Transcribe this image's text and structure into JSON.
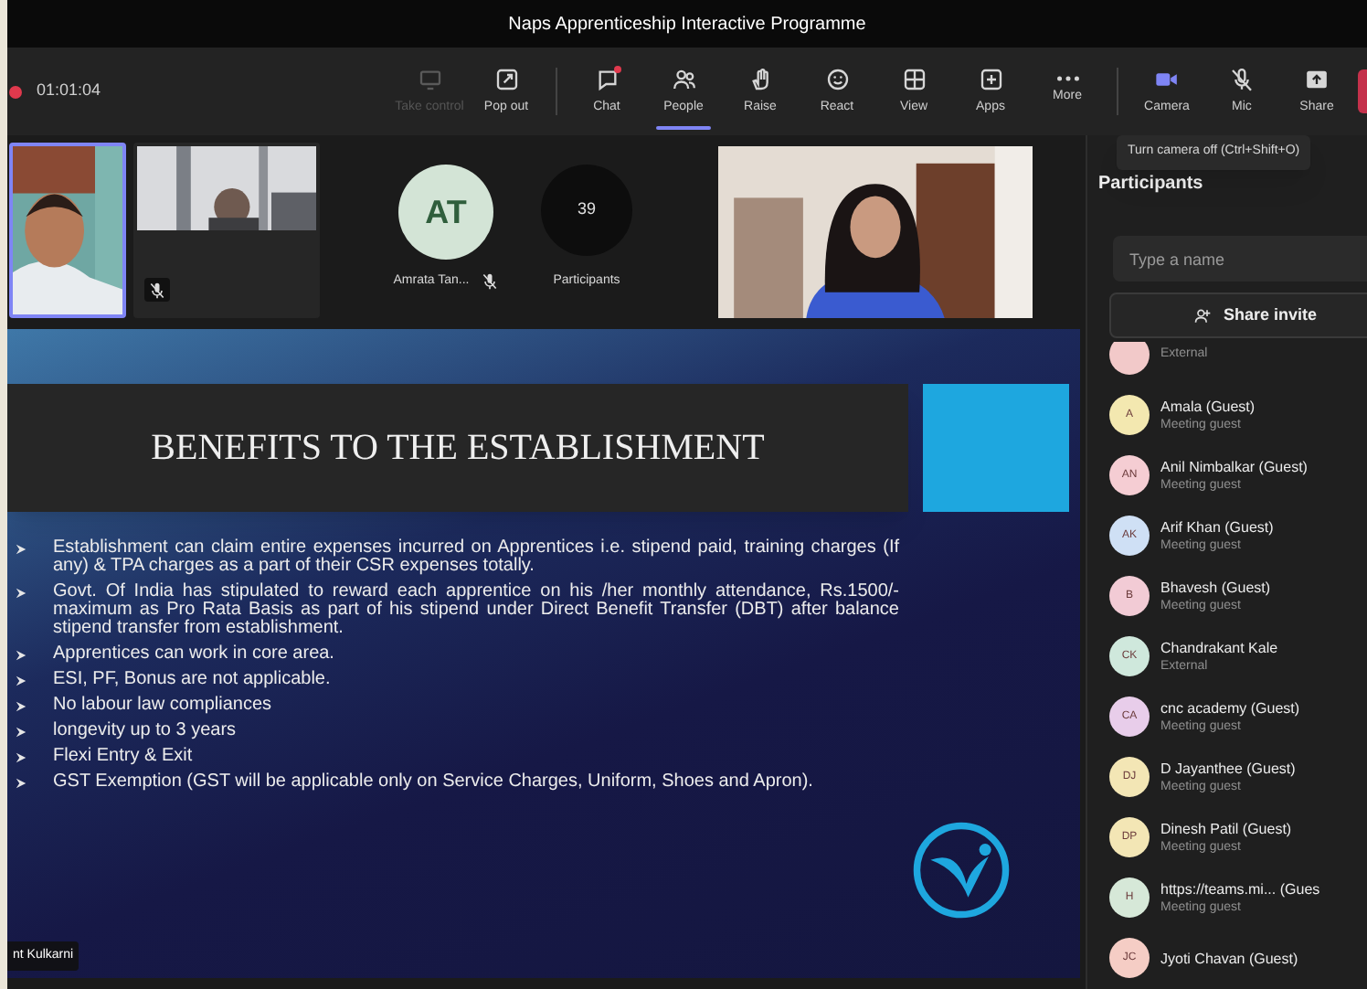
{
  "window": {
    "title": "Naps Apprenticeship Interactive Programme"
  },
  "meeting": {
    "recording": true,
    "elapsed": "01:01:04"
  },
  "toolbar": [
    {
      "label": "Take control",
      "disabled": true,
      "selected": false
    },
    {
      "label": "Pop out",
      "disabled": false,
      "selected": false
    },
    {
      "label": "Chat",
      "disabled": false,
      "selected": false,
      "notification": true
    },
    {
      "label": "People",
      "disabled": false,
      "selected": true
    },
    {
      "label": "Raise",
      "disabled": false,
      "selected": false
    },
    {
      "label": "React",
      "disabled": false,
      "selected": false
    },
    {
      "label": "View",
      "disabled": false,
      "selected": false
    },
    {
      "label": "Apps",
      "disabled": false,
      "selected": false
    },
    {
      "label": "More",
      "disabled": false,
      "selected": false
    },
    {
      "label": "Camera",
      "disabled": false,
      "selected": false,
      "on": true
    },
    {
      "label": "Mic",
      "disabled": false,
      "selected": false,
      "muted": true
    },
    {
      "label": "Share",
      "disabled": false,
      "selected": false
    }
  ],
  "tooltip": "Turn camera off (Ctrl+Shift+O)",
  "video_strip": [
    {
      "kind": "video",
      "selected": true
    },
    {
      "kind": "video",
      "selected": false,
      "muted": true
    },
    {
      "kind": "avatar",
      "initials": "AT",
      "name": "Amrata Tan...",
      "muted": true
    },
    {
      "kind": "count",
      "count": "39",
      "label": "Participants"
    },
    {
      "kind": "video",
      "selected": false
    }
  ],
  "slide": {
    "title": "BENEFITS TO THE ESTABLISHMENT",
    "bullets": [
      "Establishment can claim entire expenses incurred on Apprentices i.e. stipend paid, training charges (If any) & TPA charges as a part of their CSR expenses totally.",
      "Govt. Of India has stipulated to reward each apprentice on his /her monthly attendance, Rs.1500/- maximum as Pro Rata Basis as part of his stipend under Direct Benefit Transfer (DBT) after balance stipend transfer from establishment.",
      "Apprentices can work in core area.",
      "ESI, PF, Bonus are not applicable.",
      "No labour law compliances",
      "longevity up to 3 years",
      "Flexi Entry & Exit",
      "GST Exemption (GST will be applicable only on Service Charges, Uniform, Shoes and Apron)."
    ],
    "presenter": "nt Kulkarni"
  },
  "participants": {
    "title": "Participants",
    "search": {
      "placeholder": "Type a name"
    },
    "share_button": "Share invite",
    "items": [
      {
        "role": "External",
        "color": "#f2c9c9"
      },
      {
        "initials": "A",
        "name": "Amala (Guest)",
        "role": "Meeting guest",
        "color": "#f3e8b0"
      },
      {
        "initials": "AN",
        "name": "Anil Nimbalkar (Guest)",
        "role": "Meeting guest",
        "color": "#f5cdd3"
      },
      {
        "initials": "AK",
        "name": "Arif Khan (Guest)",
        "role": "Meeting guest",
        "color": "#cfe0f5"
      },
      {
        "initials": "B",
        "name": "Bhavesh (Guest)",
        "role": "Meeting guest",
        "color": "#f2cbd5"
      },
      {
        "initials": "CK",
        "name": "Chandrakant Kale",
        "role": "External",
        "color": "#cfe8dc"
      },
      {
        "initials": "CA",
        "name": "cnc academy (Guest)",
        "role": "Meeting guest",
        "color": "#e8cdea"
      },
      {
        "initials": "DJ",
        "name": "D Jayanthee (Guest)",
        "role": "Meeting guest",
        "color": "#f3e6b5"
      },
      {
        "initials": "DP",
        "name": "Dinesh Patil (Guest)",
        "role": "Meeting guest",
        "color": "#f3e6b5"
      },
      {
        "initials": "H",
        "name": "https://teams.mi... (Gues",
        "role": "Meeting guest",
        "color": "#d6e8d8"
      },
      {
        "initials": "JC",
        "name": "Jyoti Chavan (Guest)",
        "color": "#f5cdc5"
      }
    ]
  }
}
